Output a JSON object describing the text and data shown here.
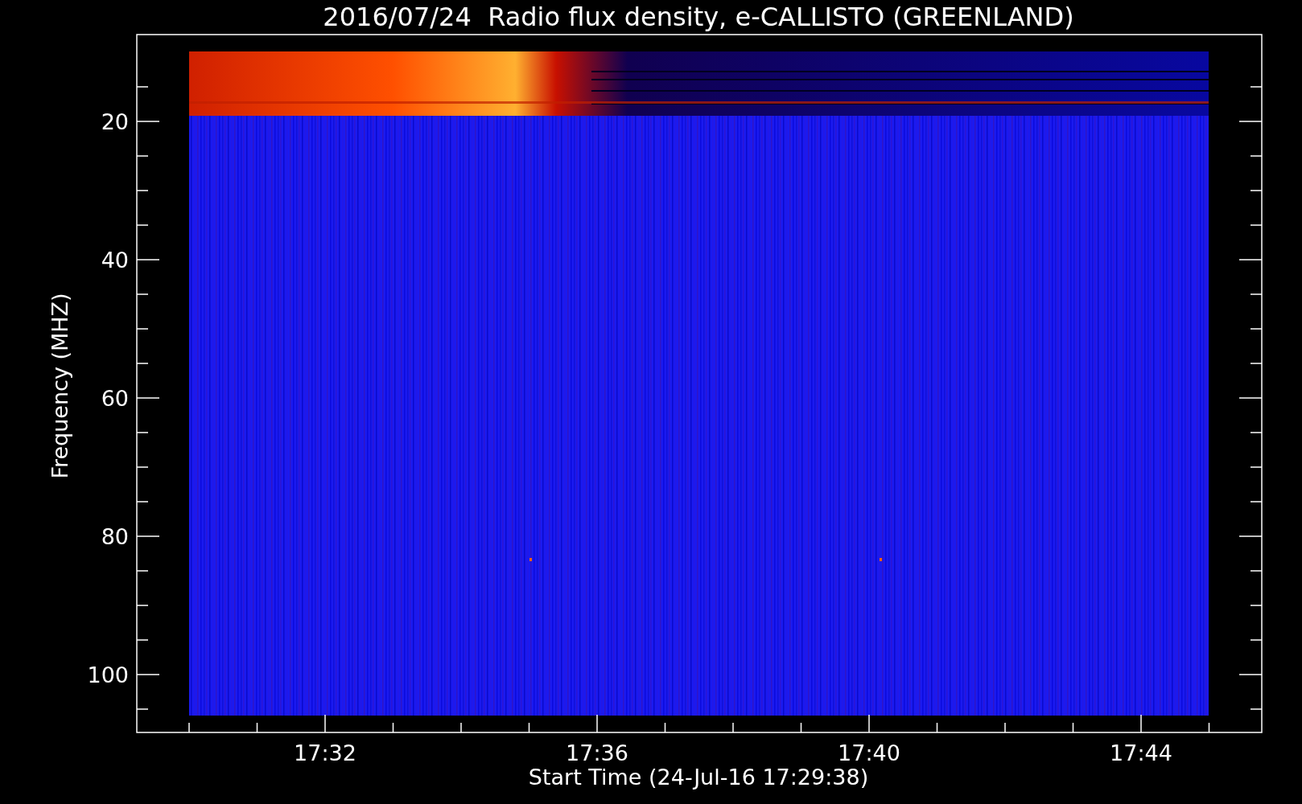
{
  "title": "2016/07/24  Radio flux density, e-CALLISTO (GREENLAND)",
  "y_axis": {
    "label": "Frequency (MHZ)",
    "ticks": [
      "20",
      "40",
      "60",
      "80",
      "100"
    ]
  },
  "x_axis": {
    "label": "Start Time (24-Jul-16 17:29:38)",
    "ticks": [
      "17:32",
      "17:36",
      "17:40",
      "17:44"
    ]
  }
}
